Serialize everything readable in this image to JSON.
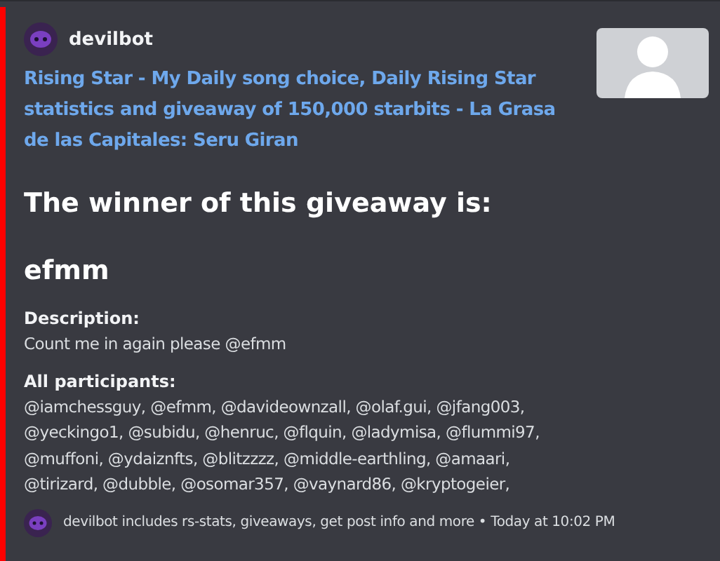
{
  "embed": {
    "author": {
      "name": "devilbot"
    },
    "title_lines": [
      "Rising Star - My Daily song choice, Daily Rising Star",
      "statistics and giveaway of 150,000 starbits  - La Grasa",
      "de las Capitales: Seru Giran"
    ],
    "heading": "The winner of this giveaway is:",
    "winner": "efmm",
    "fields": [
      {
        "name": "Description:",
        "lines": [
          "Count me in again please @efmm"
        ]
      },
      {
        "name": "All participants:",
        "lines": [
          "@iamchessguy, @efmm, @davideownzall, @olaf.gui, @jfang003,",
          "@yeckingo1, @subidu, @henruc, @flquin, @ladymisa, @flummi97,",
          "@muffoni, @ydaiznfts, @blitzzzz, @middle-earthling, @amaari,",
          "@tirizard, @dubble, @osomar357, @vaynard86, @kryptogeier,"
        ]
      }
    ],
    "footer": {
      "text": "devilbot includes rs-stats, giveaways, get post info and more",
      "separator": "•",
      "timestamp": "Today at 10:02 PM"
    }
  }
}
